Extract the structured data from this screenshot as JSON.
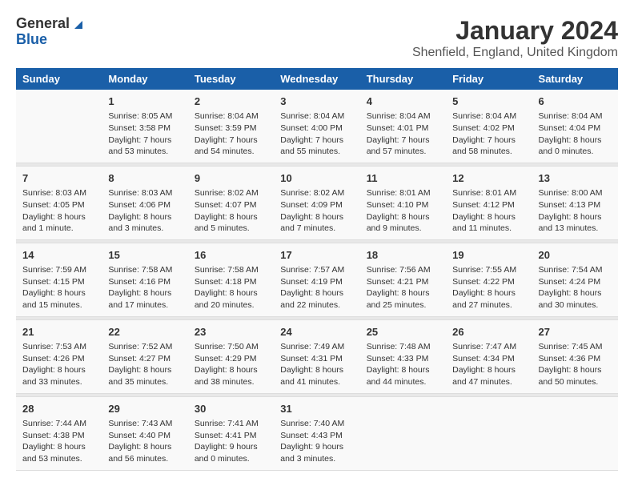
{
  "logo": {
    "general": "General",
    "blue": "Blue"
  },
  "title": "January 2024",
  "location": "Shenfield, England, United Kingdom",
  "days_header": [
    "Sunday",
    "Monday",
    "Tuesday",
    "Wednesday",
    "Thursday",
    "Friday",
    "Saturday"
  ],
  "weeks": [
    [
      {
        "day": "",
        "sunrise": "",
        "sunset": "",
        "daylight": ""
      },
      {
        "day": "1",
        "sunrise": "Sunrise: 8:05 AM",
        "sunset": "Sunset: 3:58 PM",
        "daylight": "Daylight: 7 hours and 53 minutes."
      },
      {
        "day": "2",
        "sunrise": "Sunrise: 8:04 AM",
        "sunset": "Sunset: 3:59 PM",
        "daylight": "Daylight: 7 hours and 54 minutes."
      },
      {
        "day": "3",
        "sunrise": "Sunrise: 8:04 AM",
        "sunset": "Sunset: 4:00 PM",
        "daylight": "Daylight: 7 hours and 55 minutes."
      },
      {
        "day": "4",
        "sunrise": "Sunrise: 8:04 AM",
        "sunset": "Sunset: 4:01 PM",
        "daylight": "Daylight: 7 hours and 57 minutes."
      },
      {
        "day": "5",
        "sunrise": "Sunrise: 8:04 AM",
        "sunset": "Sunset: 4:02 PM",
        "daylight": "Daylight: 7 hours and 58 minutes."
      },
      {
        "day": "6",
        "sunrise": "Sunrise: 8:04 AM",
        "sunset": "Sunset: 4:04 PM",
        "daylight": "Daylight: 8 hours and 0 minutes."
      }
    ],
    [
      {
        "day": "7",
        "sunrise": "Sunrise: 8:03 AM",
        "sunset": "Sunset: 4:05 PM",
        "daylight": "Daylight: 8 hours and 1 minute."
      },
      {
        "day": "8",
        "sunrise": "Sunrise: 8:03 AM",
        "sunset": "Sunset: 4:06 PM",
        "daylight": "Daylight: 8 hours and 3 minutes."
      },
      {
        "day": "9",
        "sunrise": "Sunrise: 8:02 AM",
        "sunset": "Sunset: 4:07 PM",
        "daylight": "Daylight: 8 hours and 5 minutes."
      },
      {
        "day": "10",
        "sunrise": "Sunrise: 8:02 AM",
        "sunset": "Sunset: 4:09 PM",
        "daylight": "Daylight: 8 hours and 7 minutes."
      },
      {
        "day": "11",
        "sunrise": "Sunrise: 8:01 AM",
        "sunset": "Sunset: 4:10 PM",
        "daylight": "Daylight: 8 hours and 9 minutes."
      },
      {
        "day": "12",
        "sunrise": "Sunrise: 8:01 AM",
        "sunset": "Sunset: 4:12 PM",
        "daylight": "Daylight: 8 hours and 11 minutes."
      },
      {
        "day": "13",
        "sunrise": "Sunrise: 8:00 AM",
        "sunset": "Sunset: 4:13 PM",
        "daylight": "Daylight: 8 hours and 13 minutes."
      }
    ],
    [
      {
        "day": "14",
        "sunrise": "Sunrise: 7:59 AM",
        "sunset": "Sunset: 4:15 PM",
        "daylight": "Daylight: 8 hours and 15 minutes."
      },
      {
        "day": "15",
        "sunrise": "Sunrise: 7:58 AM",
        "sunset": "Sunset: 4:16 PM",
        "daylight": "Daylight: 8 hours and 17 minutes."
      },
      {
        "day": "16",
        "sunrise": "Sunrise: 7:58 AM",
        "sunset": "Sunset: 4:18 PM",
        "daylight": "Daylight: 8 hours and 20 minutes."
      },
      {
        "day": "17",
        "sunrise": "Sunrise: 7:57 AM",
        "sunset": "Sunset: 4:19 PM",
        "daylight": "Daylight: 8 hours and 22 minutes."
      },
      {
        "day": "18",
        "sunrise": "Sunrise: 7:56 AM",
        "sunset": "Sunset: 4:21 PM",
        "daylight": "Daylight: 8 hours and 25 minutes."
      },
      {
        "day": "19",
        "sunrise": "Sunrise: 7:55 AM",
        "sunset": "Sunset: 4:22 PM",
        "daylight": "Daylight: 8 hours and 27 minutes."
      },
      {
        "day": "20",
        "sunrise": "Sunrise: 7:54 AM",
        "sunset": "Sunset: 4:24 PM",
        "daylight": "Daylight: 8 hours and 30 minutes."
      }
    ],
    [
      {
        "day": "21",
        "sunrise": "Sunrise: 7:53 AM",
        "sunset": "Sunset: 4:26 PM",
        "daylight": "Daylight: 8 hours and 33 minutes."
      },
      {
        "day": "22",
        "sunrise": "Sunrise: 7:52 AM",
        "sunset": "Sunset: 4:27 PM",
        "daylight": "Daylight: 8 hours and 35 minutes."
      },
      {
        "day": "23",
        "sunrise": "Sunrise: 7:50 AM",
        "sunset": "Sunset: 4:29 PM",
        "daylight": "Daylight: 8 hours and 38 minutes."
      },
      {
        "day": "24",
        "sunrise": "Sunrise: 7:49 AM",
        "sunset": "Sunset: 4:31 PM",
        "daylight": "Daylight: 8 hours and 41 minutes."
      },
      {
        "day": "25",
        "sunrise": "Sunrise: 7:48 AM",
        "sunset": "Sunset: 4:33 PM",
        "daylight": "Daylight: 8 hours and 44 minutes."
      },
      {
        "day": "26",
        "sunrise": "Sunrise: 7:47 AM",
        "sunset": "Sunset: 4:34 PM",
        "daylight": "Daylight: 8 hours and 47 minutes."
      },
      {
        "day": "27",
        "sunrise": "Sunrise: 7:45 AM",
        "sunset": "Sunset: 4:36 PM",
        "daylight": "Daylight: 8 hours and 50 minutes."
      }
    ],
    [
      {
        "day": "28",
        "sunrise": "Sunrise: 7:44 AM",
        "sunset": "Sunset: 4:38 PM",
        "daylight": "Daylight: 8 hours and 53 minutes."
      },
      {
        "day": "29",
        "sunrise": "Sunrise: 7:43 AM",
        "sunset": "Sunset: 4:40 PM",
        "daylight": "Daylight: 8 hours and 56 minutes."
      },
      {
        "day": "30",
        "sunrise": "Sunrise: 7:41 AM",
        "sunset": "Sunset: 4:41 PM",
        "daylight": "Daylight: 9 hours and 0 minutes."
      },
      {
        "day": "31",
        "sunrise": "Sunrise: 7:40 AM",
        "sunset": "Sunset: 4:43 PM",
        "daylight": "Daylight: 9 hours and 3 minutes."
      },
      {
        "day": "",
        "sunrise": "",
        "sunset": "",
        "daylight": ""
      },
      {
        "day": "",
        "sunrise": "",
        "sunset": "",
        "daylight": ""
      },
      {
        "day": "",
        "sunrise": "",
        "sunset": "",
        "daylight": ""
      }
    ]
  ]
}
